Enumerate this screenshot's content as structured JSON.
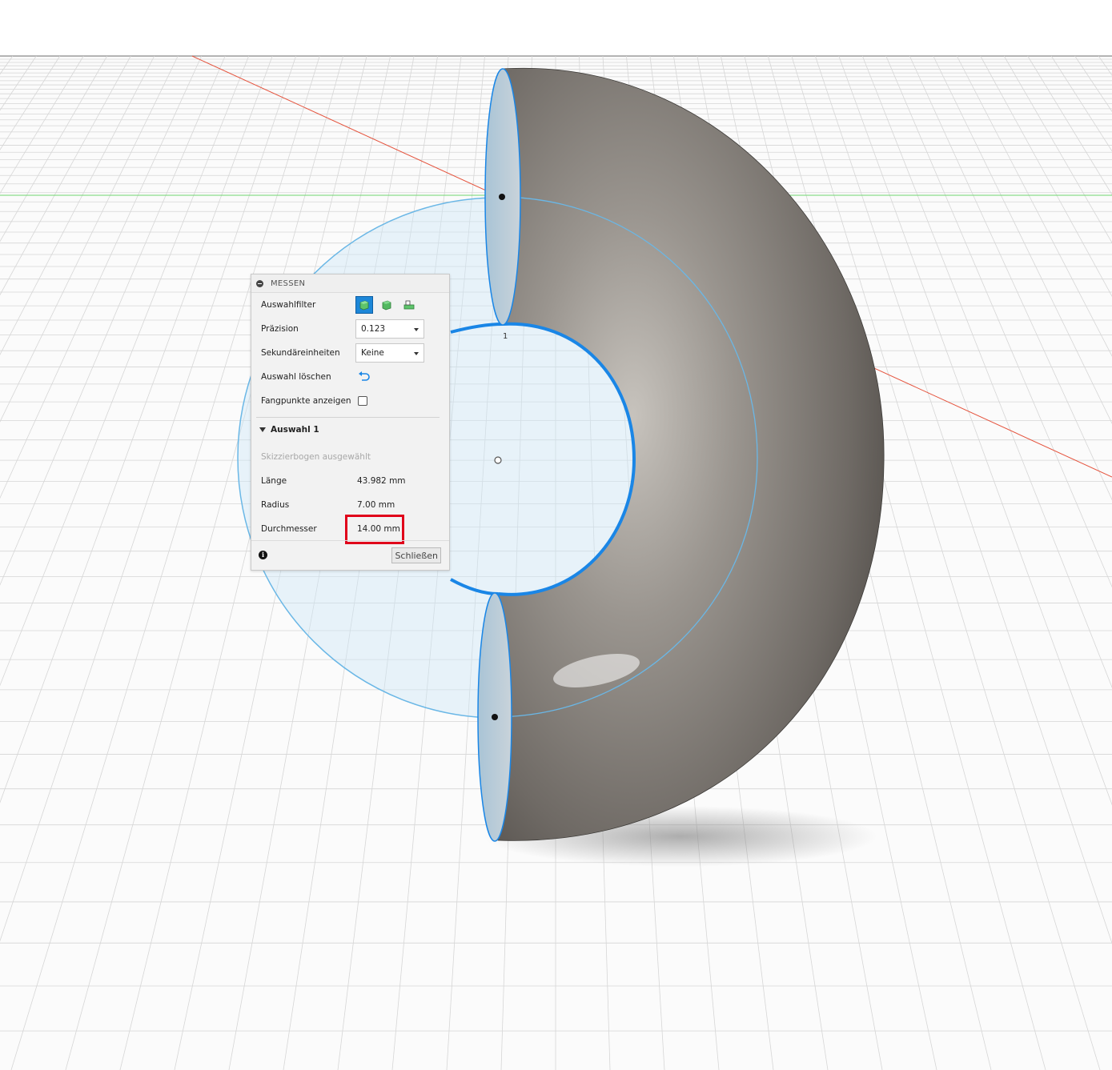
{
  "viewport": {
    "point_label": "1",
    "colors": {
      "background": "#ffffff",
      "grid": "#d4d4d4",
      "x_axis": "#e5533d",
      "y_axis": "#5ad05a",
      "selection_blue": "#1a86e6",
      "sketch_circle": "#6ab7e6",
      "body": "#77726c"
    }
  },
  "panel": {
    "title": "MESSEN",
    "rows": {
      "selection_filter_label": "Auswahlfilter",
      "precision_label": "Präzision",
      "precision_value": "0.123",
      "secondary_units_label": "Sekundäreinheiten",
      "secondary_units_value": "Keine",
      "clear_selection_label": "Auswahl löschen",
      "show_snap_points_label": "Fangpunkte anzeigen"
    },
    "filter_icons": [
      "body-filter-icon",
      "face-filter-icon",
      "edge-filter-icon"
    ],
    "section": {
      "title": "Auswahl 1",
      "selected_type": "Skizzierbogen ausgewählt",
      "length_label": "Länge",
      "length_value": "43.982 mm",
      "radius_label": "Radius",
      "radius_value": "7.00 mm",
      "diameter_label": "Durchmesser",
      "diameter_value": "14.00 mm"
    },
    "close_label": "Schließen"
  }
}
